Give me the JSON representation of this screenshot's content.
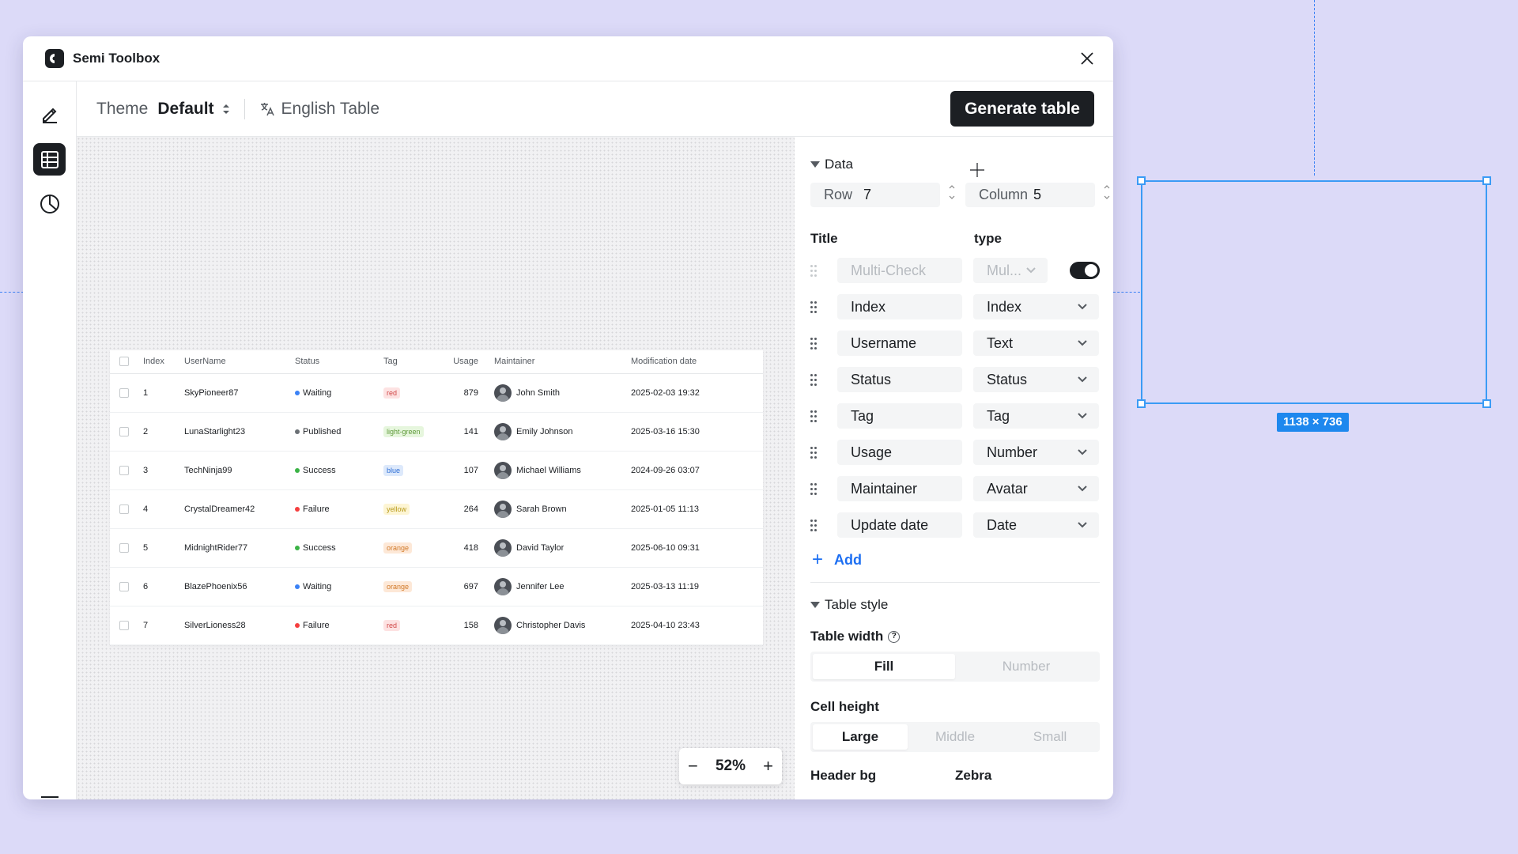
{
  "window": {
    "title": "Semi Toolbox"
  },
  "toolbar": {
    "theme_label": "Theme",
    "theme_value": "Default",
    "language": "English Table",
    "generate_label": "Generate table"
  },
  "preview": {
    "columns": [
      "Index",
      "UserName",
      "Status",
      "Tag",
      "Usage",
      "Maintainer",
      "Modification date"
    ],
    "rows": [
      {
        "index": "1",
        "username": "SkyPioneer87",
        "status": "Waiting",
        "status_color": "#3b82f6",
        "tag": "red",
        "tag_bg": "#fde2e2",
        "tag_fg": "#d04848",
        "usage": "879",
        "maintainer": "John Smith",
        "date": "2025-02-03 19:32"
      },
      {
        "index": "2",
        "username": "LunaStarlight23",
        "status": "Published",
        "status_color": "#6b7075",
        "tag": "light-green",
        "tag_bg": "#e6f6dd",
        "tag_fg": "#5f9a3a",
        "usage": "141",
        "maintainer": "Emily Johnson",
        "date": "2025-03-16 15:30"
      },
      {
        "index": "3",
        "username": "TechNinja99",
        "status": "Success",
        "status_color": "#3bb346",
        "tag": "blue",
        "tag_bg": "#dde9fb",
        "tag_fg": "#2f6fd6",
        "usage": "107",
        "maintainer": "Michael Williams",
        "date": "2024-09-26 03:07"
      },
      {
        "index": "4",
        "username": "CrystalDreamer42",
        "status": "Failure",
        "status_color": "#f53f3f",
        "tag": "yellow",
        "tag_bg": "#fdf5d4",
        "tag_fg": "#b89a1b",
        "usage": "264",
        "maintainer": "Sarah Brown",
        "date": "2025-01-05 11:13"
      },
      {
        "index": "5",
        "username": "MidnightRider77",
        "status": "Success",
        "status_color": "#3bb346",
        "tag": "orange",
        "tag_bg": "#fde8d7",
        "tag_fg": "#d17a2a",
        "usage": "418",
        "maintainer": "David Taylor",
        "date": "2025-06-10 09:31"
      },
      {
        "index": "6",
        "username": "BlazePhoenix56",
        "status": "Waiting",
        "status_color": "#3b82f6",
        "tag": "orange",
        "tag_bg": "#fde8d7",
        "tag_fg": "#d17a2a",
        "usage": "697",
        "maintainer": "Jennifer Lee",
        "date": "2025-03-13 11:19"
      },
      {
        "index": "7",
        "username": "SilverLioness28",
        "status": "Failure",
        "status_color": "#f53f3f",
        "tag": "red",
        "tag_bg": "#fde2e2",
        "tag_fg": "#d04848",
        "usage": "158",
        "maintainer": "Christopher Davis",
        "date": "2025-04-10 23:43"
      }
    ]
  },
  "zoom": {
    "value": "52%",
    "minus": "−",
    "plus": "+"
  },
  "panel": {
    "data_section": "Data",
    "row_label": "Row",
    "row_value": "7",
    "column_label": "Column",
    "column_value": "5",
    "title_header": "Title",
    "type_header": "type",
    "multi_check": {
      "title": "Multi-Check",
      "type": "Mul..."
    },
    "columns": [
      {
        "title": "Index",
        "type": "Index"
      },
      {
        "title": "Username",
        "type": "Text"
      },
      {
        "title": "Status",
        "type": "Status"
      },
      {
        "title": "Tag",
        "type": "Tag"
      },
      {
        "title": "Usage",
        "type": "Number"
      },
      {
        "title": "Maintainer",
        "type": "Avatar"
      },
      {
        "title": "Update date",
        "type": "Date"
      }
    ],
    "add_label": "Add",
    "style_section": "Table style",
    "table_width_label": "Table width",
    "width_options": [
      "Fill",
      "Number"
    ],
    "cell_height_label": "Cell height",
    "height_options": [
      "Large",
      "Middle",
      "Small"
    ],
    "header_bg_label": "Header bg",
    "zebra_label": "Zebra"
  },
  "canvas_overlay": {
    "dimensions": "1138 × 736"
  }
}
